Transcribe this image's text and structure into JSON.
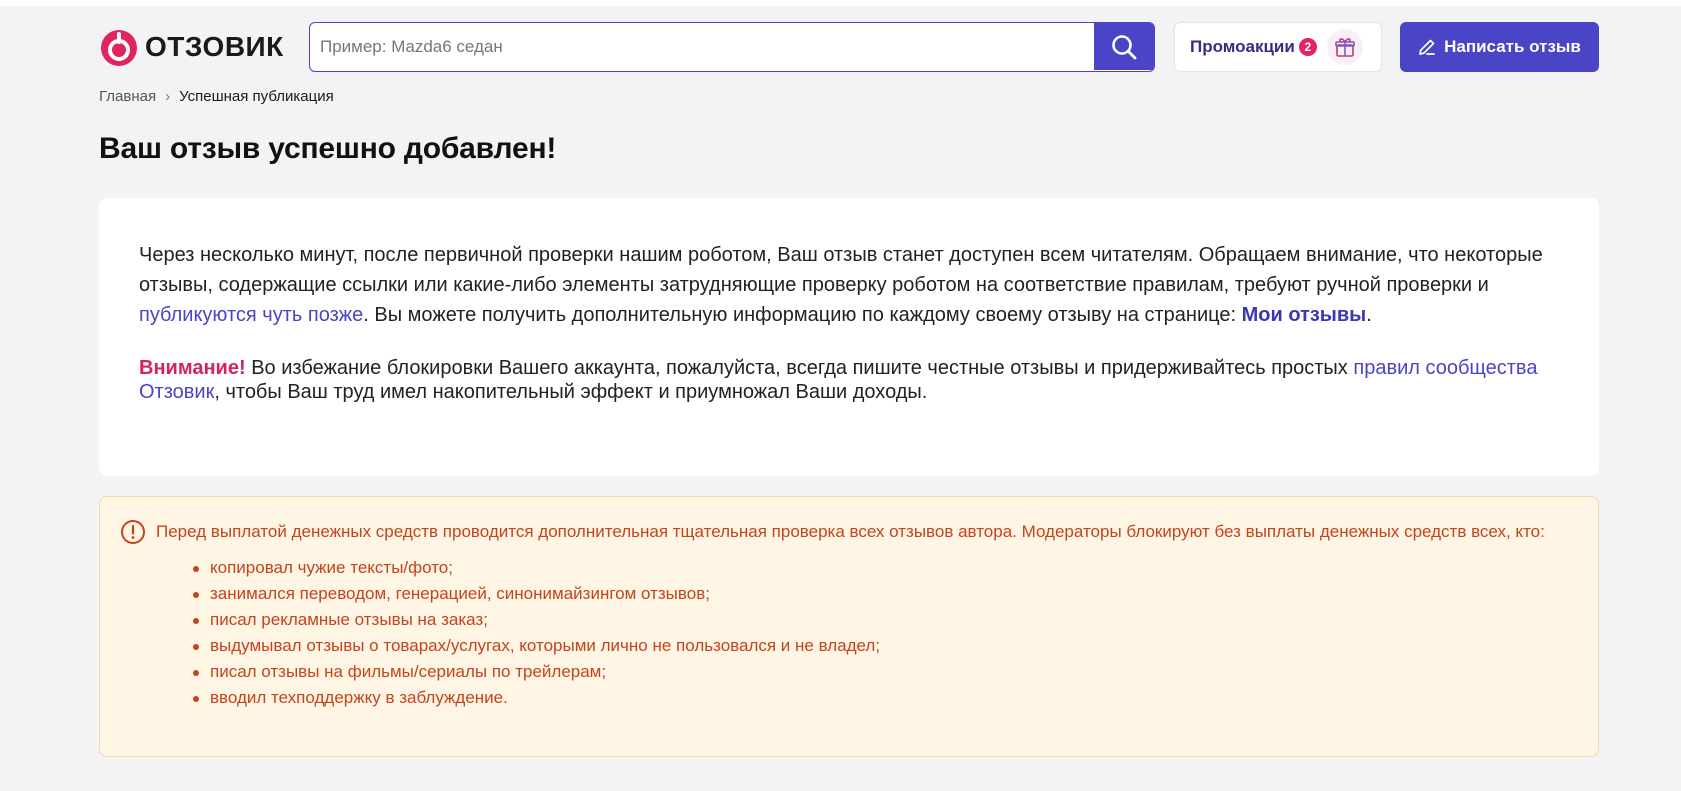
{
  "brand": {
    "name": "ОТЗОВИК",
    "accent": "#e0245e",
    "primary": "#4a44c6"
  },
  "search": {
    "placeholder": "Пример: Mazda6 седан",
    "value": "",
    "icon": "search-icon"
  },
  "promo": {
    "label": "Промоакции",
    "count": "2",
    "icon": "gift-icon"
  },
  "write_button": {
    "label": "Написать отзыв",
    "icon": "pencil-icon"
  },
  "breadcrumb": {
    "home": "Главная",
    "separator": "›",
    "current": "Успешная публикация"
  },
  "page_title": "Ваш отзыв успешно добавлен!",
  "message": {
    "p1_part1": "Через несколько минут, после первичной проверки нашим роботом, Ваш отзыв станет доступен всем читателям. Обращаем внимание, что некоторые отзывы, содержащие ссылки или какие-либо элементы затрудняющие проверку роботом на соответствие правилам, требуют ручной проверки и ",
    "p1_link": "публикуются чуть позже",
    "p1_part2": ". Вы можете получить дополнительную информацию по каждому своему отзыву на странице: ",
    "p1_link2": "Мои отзывы",
    "p1_end": ".",
    "warn_label": "Внимание!",
    "warn_part1": " Во избежание блокировки Вашего аккаунта, пожалуйста, всегда пишите честные отзывы и придерживайтесь простых ",
    "warn_link": "правил сообщества Отзовик",
    "warn_part2": ", чтобы Ваш труд имел накопительный эффект и приумножал Ваши доходы."
  },
  "alert": {
    "icon": "exclamation-circle-icon",
    "text": "Перед выплатой денежных средств проводится дополнительная тщательная проверка всех отзывов автора. Модераторы блокируют без выплаты денежных средств всех, кто:",
    "items": [
      "копировал чужие тексты/фото;",
      "занимался переводом, генерацией, синонимайзингом отзывов;",
      "писал рекламные отзывы на заказ;",
      "выдумывал отзывы о товарах/услугах, которыми лично не пользовался и не владел;",
      "писал отзывы на фильмы/сериалы по трейлерам;",
      "вводил техподдержку в заблуждение."
    ]
  }
}
